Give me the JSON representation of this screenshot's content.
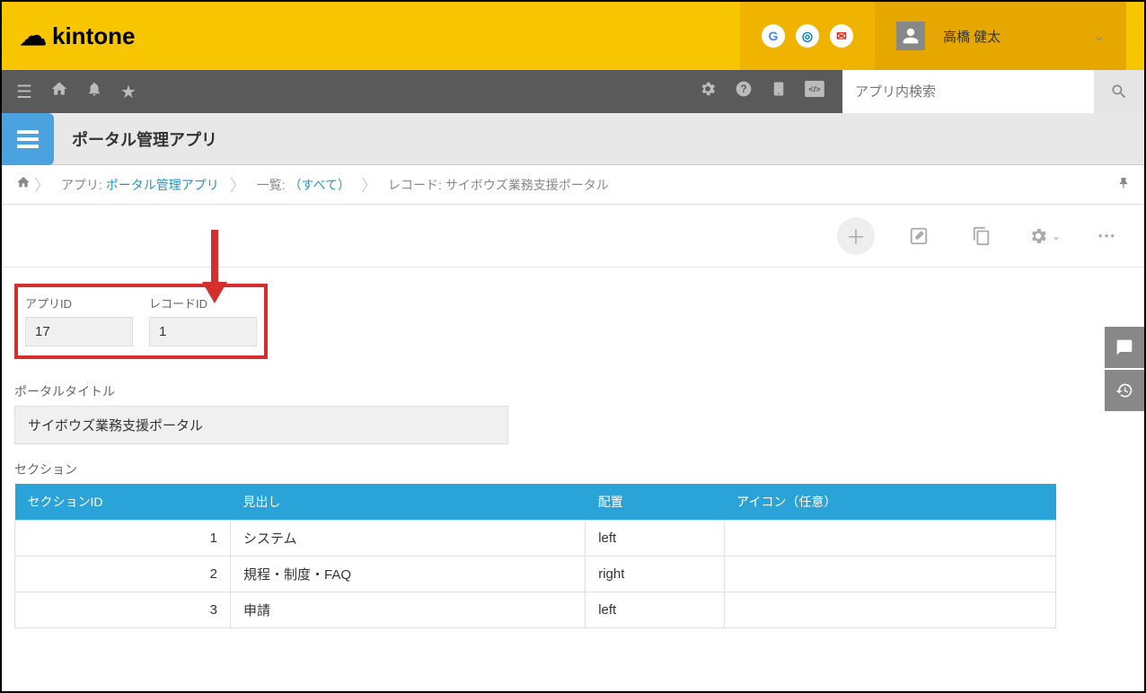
{
  "header": {
    "product_name": "kintone",
    "user_name": "高橋 健太"
  },
  "toolbar": {
    "search_placeholder": "アプリ内検索"
  },
  "app_title": "ポータル管理アプリ",
  "breadcrumb": {
    "app_prefix": "アプリ: ",
    "app_link": "ポータル管理アプリ",
    "list_prefix": "一覧: ",
    "list_link": "（すべて）",
    "record_prefix": "レコード: ",
    "record_text": "サイボウズ業務支援ポータル"
  },
  "fields": {
    "app_id_label": "アプリID",
    "app_id_value": "17",
    "record_id_label": "レコードID",
    "record_id_value": "1",
    "portal_title_label": "ポータルタイトル",
    "portal_title_value": "サイボウズ業務支援ポータル",
    "section_label": "セクション"
  },
  "section_table": {
    "headers": {
      "id": "セクションID",
      "heading": "見出し",
      "placement": "配置",
      "icon": "アイコン（任意）"
    },
    "rows": [
      {
        "id": "1",
        "heading": "システム",
        "placement": "left",
        "icon": ""
      },
      {
        "id": "2",
        "heading": "規程・制度・FAQ",
        "placement": "right",
        "icon": ""
      },
      {
        "id": "3",
        "heading": "申請",
        "placement": "left",
        "icon": ""
      }
    ]
  }
}
